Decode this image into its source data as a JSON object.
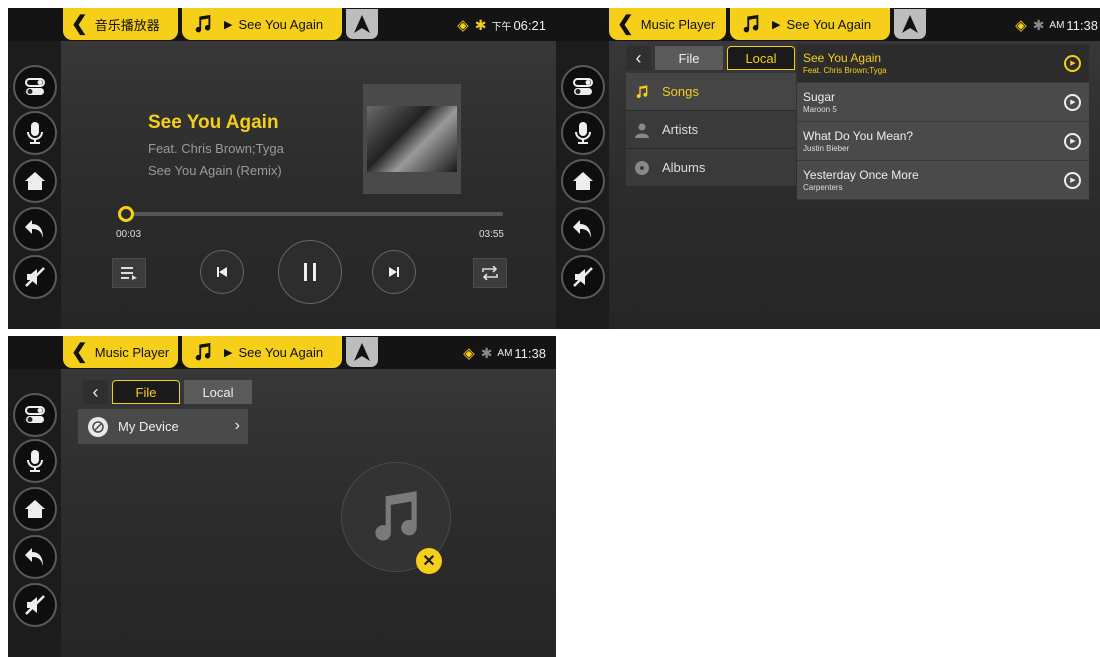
{
  "colors": {
    "accent": "#f5cf1a",
    "background": "#2b2b2b",
    "rail": "#1c1c1c"
  },
  "screen1": {
    "header": {
      "back_label": "音乐播放器",
      "now_playing": "See You Again",
      "time_prefix": "下午",
      "time": "06:21"
    },
    "rail_icons": [
      "toggle-icon",
      "microphone-icon",
      "home-icon",
      "back-arrow-icon",
      "mute-icon"
    ],
    "track": {
      "title": "See You Again",
      "artist": "Feat. Chris Brown;Tyga",
      "album": "See You Again (Remix)"
    },
    "progress": {
      "current": "00:03",
      "total": "03:55",
      "fraction": 0.013
    },
    "controls": [
      "playlist-icon",
      "previous-icon",
      "pause-icon",
      "next-icon",
      "repeat-icon"
    ]
  },
  "screen2": {
    "header": {
      "back_label": "Music Player",
      "now_playing": "See You Again",
      "time_prefix": "AM",
      "time": "11:38"
    },
    "tabs": {
      "file": "File",
      "local": "Local",
      "active": "Local"
    },
    "categories": [
      {
        "label": "Songs",
        "icon": "music-note-icon",
        "selected": true
      },
      {
        "label": "Artists",
        "icon": "person-icon",
        "selected": false
      },
      {
        "label": "Albums",
        "icon": "disc-icon",
        "selected": false
      }
    ],
    "songs": [
      {
        "title": "See You Again",
        "artist": "Feat. Chris Brown;Tyga",
        "selected": true
      },
      {
        "title": "Sugar",
        "artist": "Maroon 5",
        "selected": false
      },
      {
        "title": "What Do You Mean?",
        "artist": "Justin Bieber",
        "selected": false
      },
      {
        "title": "Yesterday Once More",
        "artist": "Carpenters",
        "selected": false
      }
    ]
  },
  "screen3": {
    "header": {
      "back_label": "Music Player",
      "now_playing": "See You Again",
      "time_prefix": "AM",
      "time": "11:38"
    },
    "tabs": {
      "file": "File",
      "local": "Local",
      "active": "File"
    },
    "device": {
      "label": "My Device",
      "icon": "device-icon"
    },
    "empty_state": {
      "icon": "music-note-icon",
      "badge": "close-icon"
    }
  }
}
